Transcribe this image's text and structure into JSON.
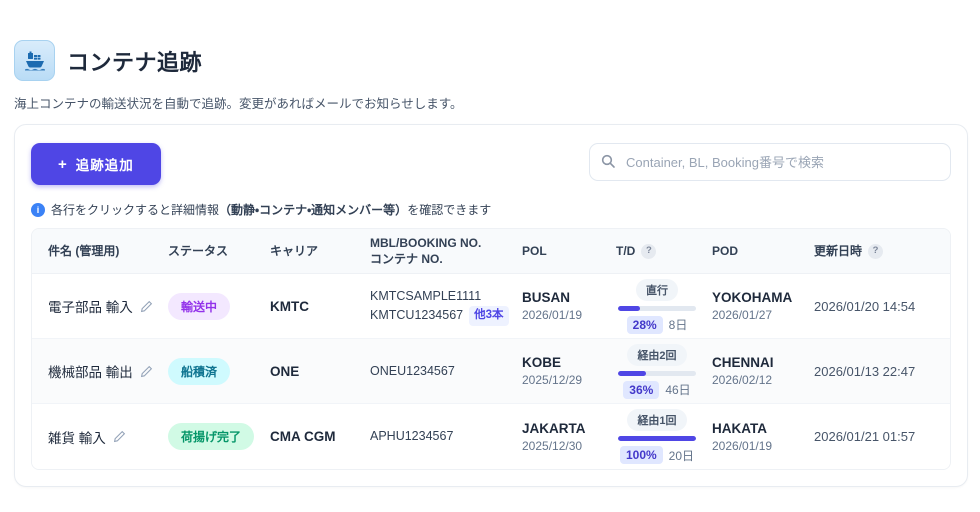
{
  "page": {
    "title": "コンテナ追跡",
    "subtitle": "海上コンテナの輸送状況を自動で追跡。変更があればメールでお知らせします。"
  },
  "toolbar": {
    "add_button_label": "追跡追加",
    "add_button_plus": "+",
    "search_placeholder": "Container, BL, Booking番号で検索"
  },
  "note": {
    "icon": "info-icon",
    "prefix": "各行をクリックすると詳細情報",
    "bold": "（動静・コンテナ・通知メンバー等）",
    "suffix": "を確認できます"
  },
  "theme": {
    "accent": "#4f46e5",
    "status_transit": {
      "bg": "#f3e8ff",
      "text": "#9333ea"
    },
    "status_shipped": {
      "bg": "#cffafe",
      "text": "#0e7490"
    },
    "status_unloaded": {
      "bg": "#d1fae5",
      "text": "#059669"
    },
    "progress_fill": "#4f46e5",
    "progress_track": "#e2e8f0"
  },
  "table": {
    "headers": {
      "name": "件名 (管理用)",
      "status": "ステータス",
      "carrier": "キャリア",
      "mbl_line1": "MBL/BOOKING NO.",
      "mbl_line2": "コンテナ NO.",
      "pol": "POL",
      "td": "T/D",
      "td_help": "?",
      "pod": "POD",
      "updated": "更新日時",
      "updated_help": "?"
    },
    "rows": [
      {
        "name": "電子部品 輸入",
        "status": "輸送中",
        "status_type": "transit",
        "carrier": "KMTC",
        "mbl_line1": "KMTCSAMPLE1111",
        "mbl_line2": "KMTCU1234567",
        "extra": "他3本",
        "pol_port": "BUSAN",
        "pol_date": "2026/01/19",
        "td_route": "直行",
        "td_percent": "28%",
        "td_days": "8日",
        "pod_port": "YOKOHAMA",
        "pod_date": "2026/01/27",
        "updated": "2026/01/20 14:54"
      },
      {
        "name": "機械部品 輸出",
        "status": "船積済",
        "status_type": "shipped",
        "carrier": "ONE",
        "mbl_line1": "ONEU1234567",
        "mbl_line2": "",
        "extra": "",
        "pol_port": "KOBE",
        "pol_date": "2025/12/29",
        "td_route": "経由2回",
        "td_percent": "36%",
        "td_days": "46日",
        "pod_port": "CHENNAI",
        "pod_date": "2026/02/12",
        "updated": "2026/01/13 22:47"
      },
      {
        "name": "雑貨 輸入",
        "status": "荷揚げ完了",
        "status_type": "unloaded",
        "carrier": "CMA CGM",
        "mbl_line1": "APHU1234567",
        "mbl_line2": "",
        "extra": "",
        "pol_port": "JAKARTA",
        "pol_date": "2025/12/30",
        "td_route": "経由1回",
        "td_percent": "100%",
        "td_days": "20日",
        "pod_port": "HAKATA",
        "pod_date": "2026/01/19",
        "updated": "2026/01/21 01:57"
      }
    ]
  }
}
